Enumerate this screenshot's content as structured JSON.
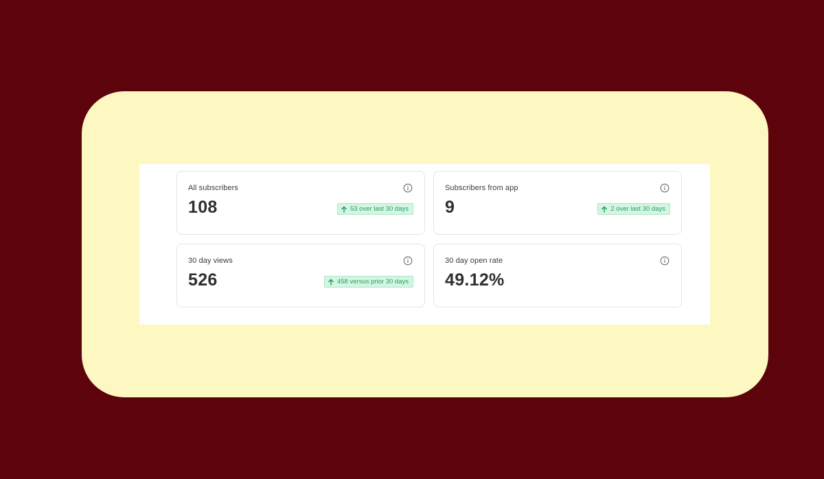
{
  "stats": [
    {
      "label": "All subscribers",
      "value": "108",
      "delta": "53 over last 30 days",
      "delta_direction": "up",
      "info_icon": "info-icon"
    },
    {
      "label": "Subscribers from app",
      "value": "9",
      "delta": "2 over last 30 days",
      "delta_direction": "up",
      "info_icon": "info-icon"
    },
    {
      "label": "30 day views",
      "value": "526",
      "delta": "458 versus prior 30 days",
      "delta_direction": "up",
      "info_icon": "info-icon"
    },
    {
      "label": "30 day open rate",
      "value": "49.12%",
      "info_icon": "info-icon"
    }
  ],
  "colors": {
    "outer_background": "#5c030b",
    "frame_background": "#fdf7c1",
    "panel_background": "#ffffff",
    "positive_badge_background": "#d3f6e3",
    "positive_badge_text": "#2c9a62"
  }
}
